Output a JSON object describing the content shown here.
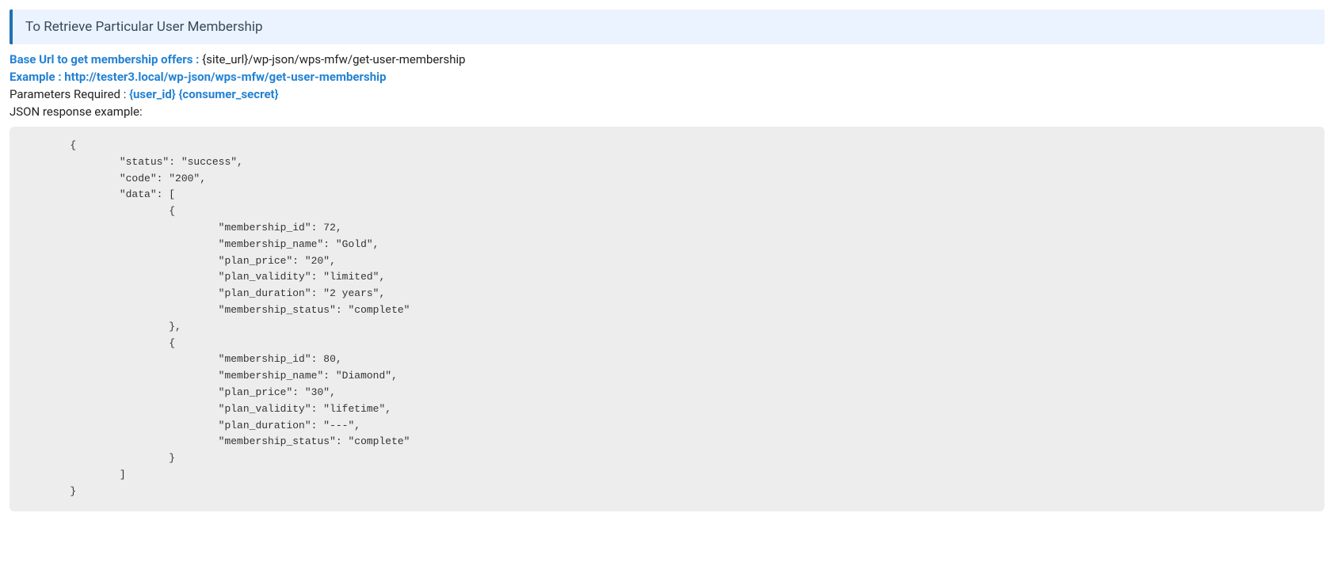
{
  "callout": {
    "title": "To Retrieve Particular User Membership"
  },
  "base_url": {
    "label": "Base Url to get membership offers : ",
    "value": "{site_url}/wp-json/wps-mfw/get-user-membership"
  },
  "example": {
    "label": "Example : ",
    "url": "http://tester3.local/wp-json/wps-mfw/get-user-membership"
  },
  "parameters": {
    "label": "Parameters Required : ",
    "value": "{user_id} {consumer_secret}"
  },
  "json_label": "JSON response example:",
  "code": "        {\n                \"status\": \"success\",\n                \"code\": \"200\",\n                \"data\": [\n                        {\n                                \"membership_id\": 72,\n                                \"membership_name\": \"Gold\",\n                                \"plan_price\": \"20\",\n                                \"plan_validity\": \"limited\",\n                                \"plan_duration\": \"2 years\",\n                                \"membership_status\": \"complete\"\n                        },\n                        {\n                                \"membership_id\": 80,\n                                \"membership_name\": \"Diamond\",\n                                \"plan_price\": \"30\",\n                                \"plan_validity\": \"lifetime\",\n                                \"plan_duration\": \"---\",\n                                \"membership_status\": \"complete\"\n                        }\n                ]\n        }"
}
